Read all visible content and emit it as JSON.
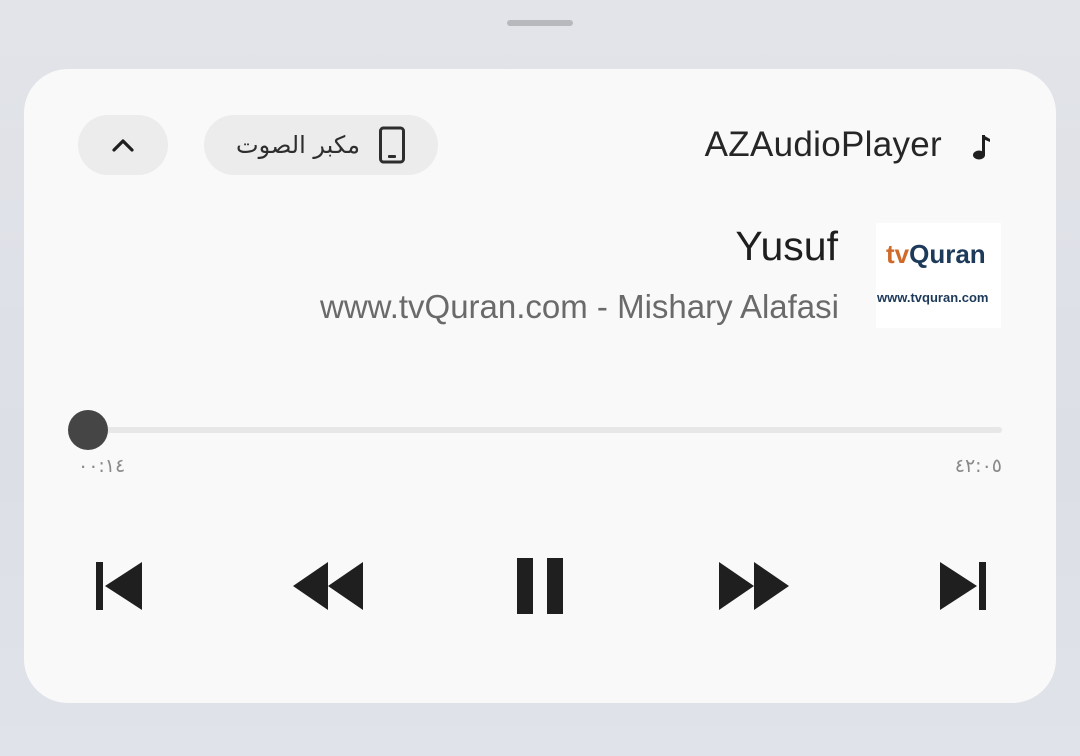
{
  "header": {
    "app_name": "AZAudioPlayer",
    "app_icon": "music-note-icon",
    "output_device_label": "مكبر الصوت",
    "output_device_icon": "phone-icon",
    "collapse_icon": "chevron-up-icon"
  },
  "track": {
    "title": "Yusuf",
    "artist": "www.tvQuran.com - Mishary Alafasi",
    "artwork": {
      "logo_prefix": "tv",
      "logo_word": "Quran",
      "url": "www.tvquran.com"
    }
  },
  "progress": {
    "elapsed": "٠٠:١٤",
    "duration": "٤٢:٠٥",
    "fraction": 0.0055
  },
  "controls": {
    "previous_icon": "skip-previous-icon",
    "rewind_icon": "rewind-icon",
    "pause_icon": "pause-icon",
    "fast_forward_icon": "fast-forward-icon",
    "next_icon": "skip-next-icon"
  },
  "colors": {
    "card_background": "#f9f9f9",
    "control_color": "#1f1f1f",
    "logo_orange": "#d06a2a",
    "logo_navy": "#1d3a5a"
  }
}
